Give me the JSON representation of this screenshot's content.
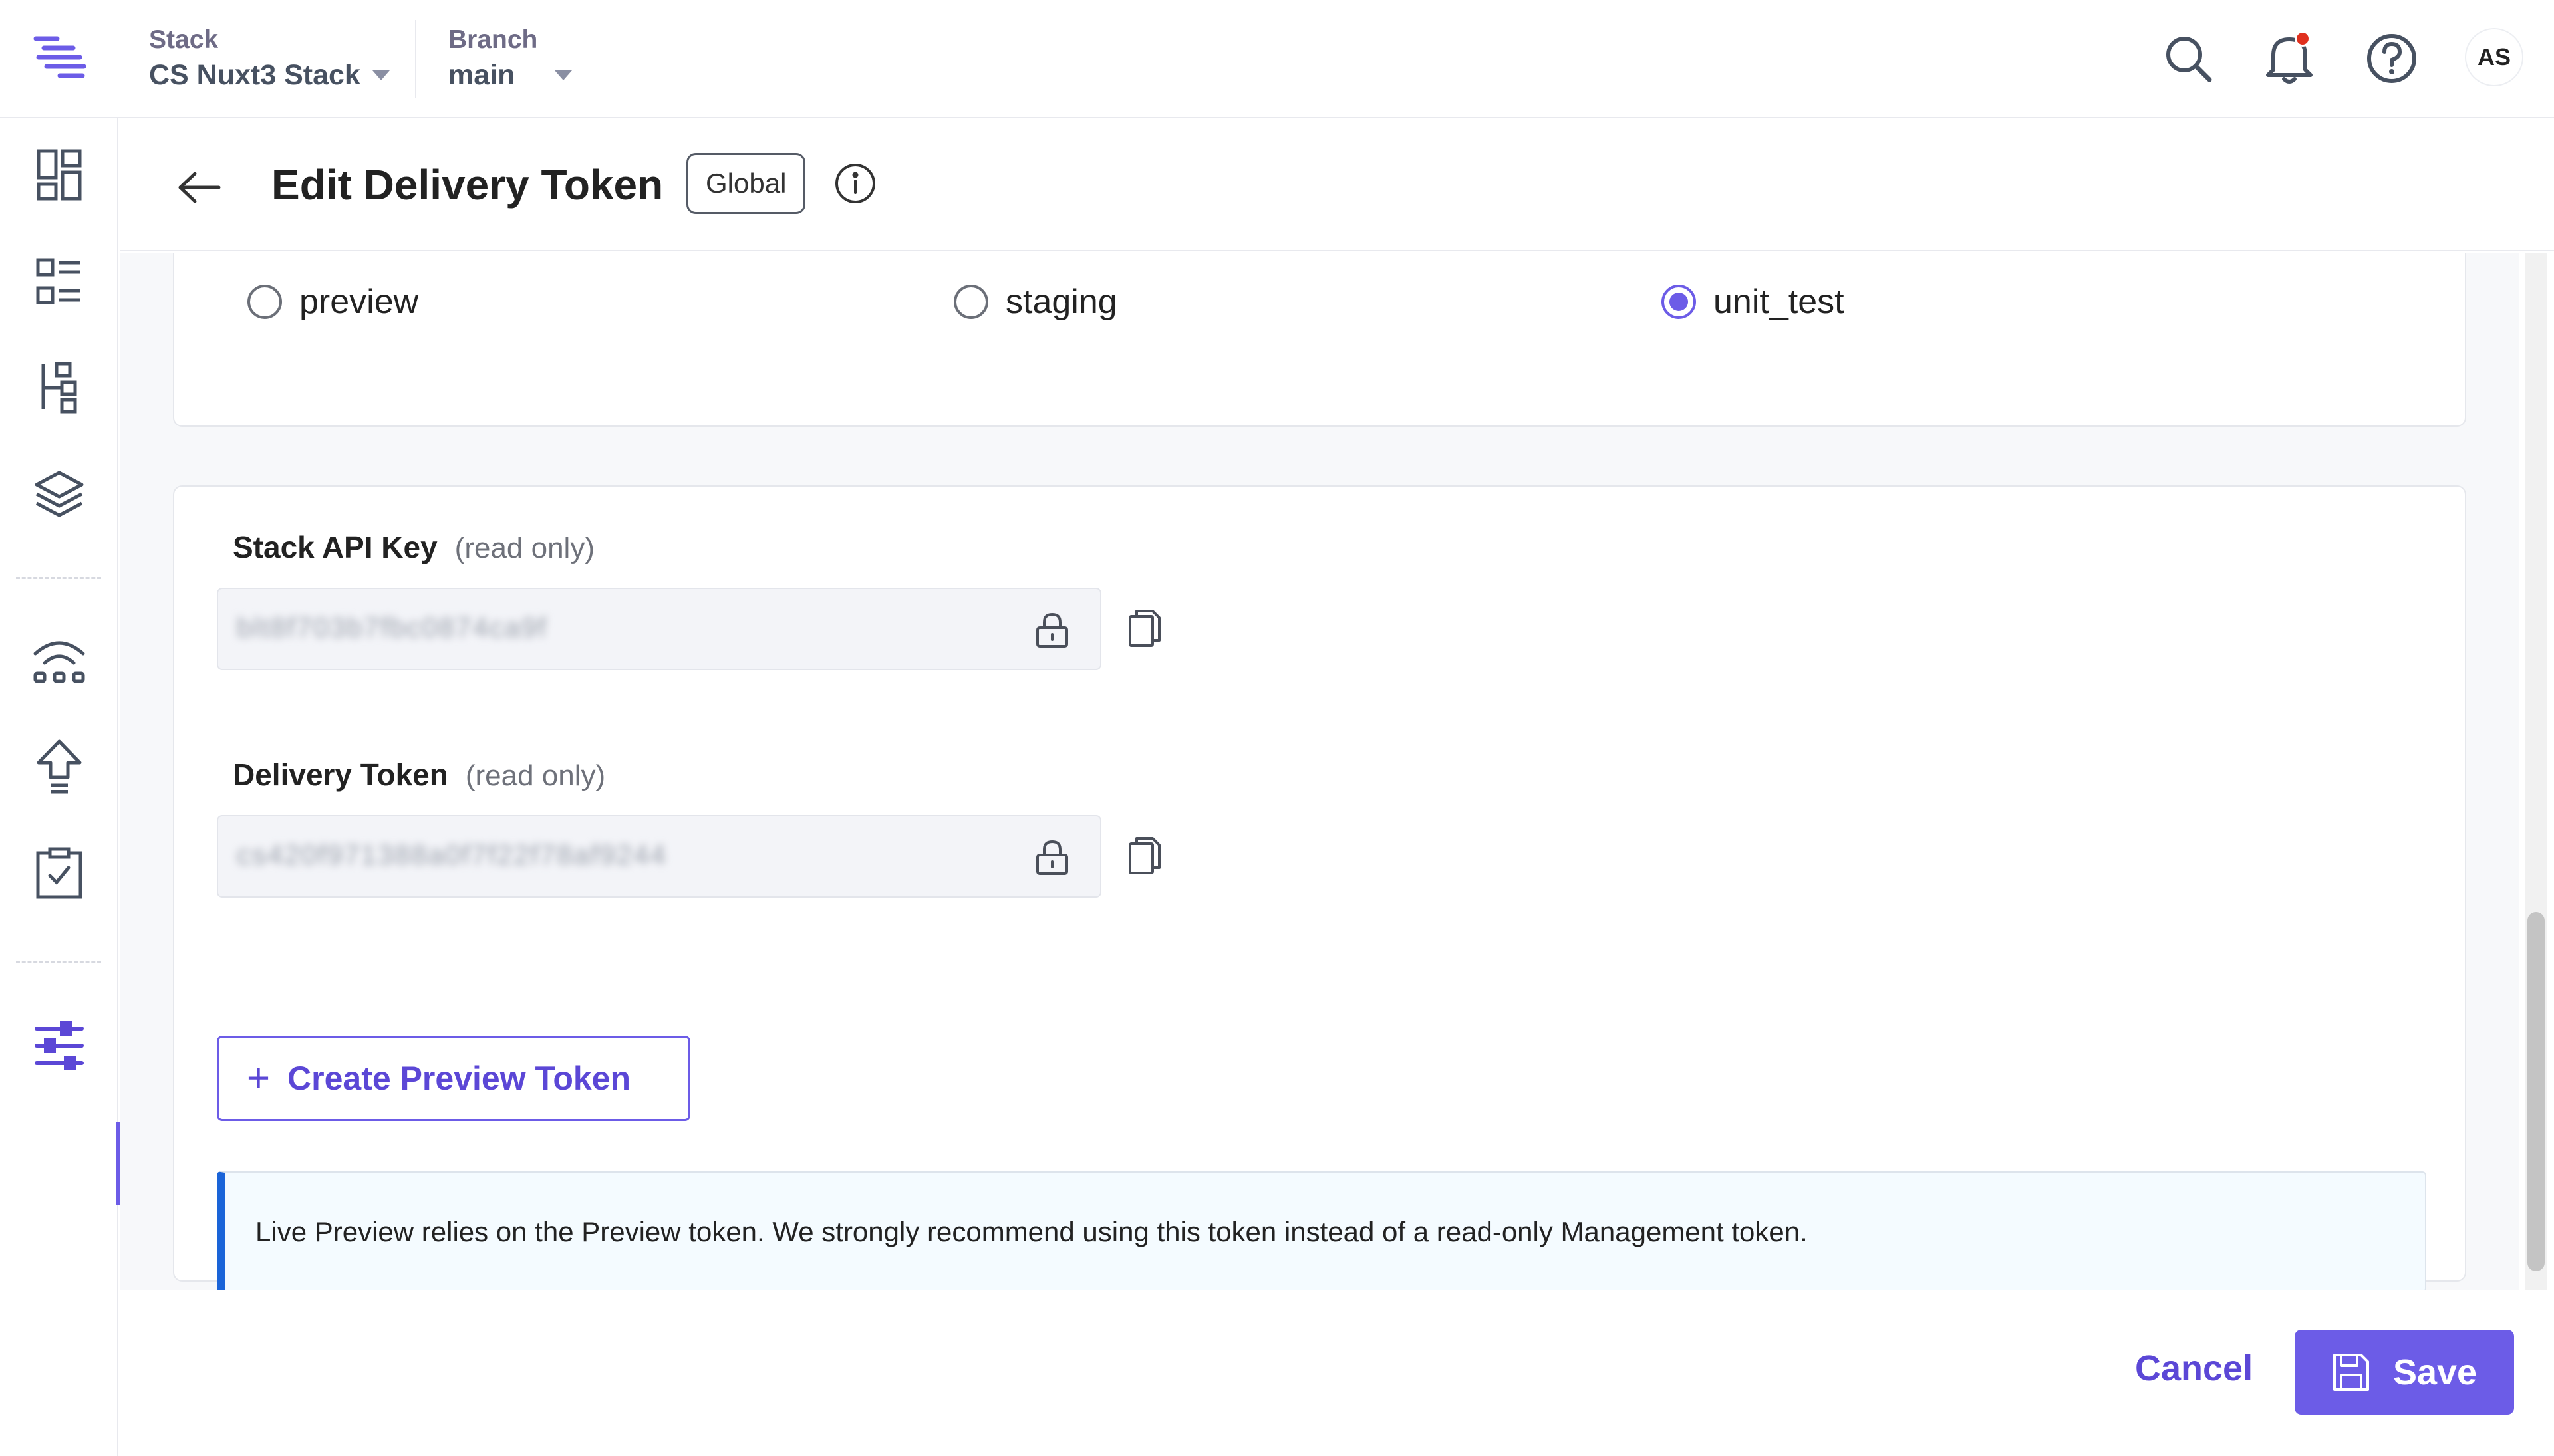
{
  "header": {
    "stack_label": "Stack",
    "stack_name": "CS Nuxt3 Stack",
    "branch_label": "Branch",
    "branch_name": "main",
    "avatar_initials": "AS",
    "icons": [
      "search-icon",
      "bell-icon",
      "help-icon"
    ]
  },
  "sidebar": {
    "items": [
      "dashboard-icon",
      "entries-icon",
      "content-models-icon",
      "assets-icon",
      "releases-icon",
      "deploy-icon",
      "tasks-icon",
      "settings-icon"
    ],
    "active": "settings-icon"
  },
  "page": {
    "title": "Edit Delivery Token",
    "scope_badge": "Global"
  },
  "environments": {
    "options": [
      {
        "label": "preview",
        "checked": false
      },
      {
        "label": "staging",
        "checked": false
      },
      {
        "label": "unit_test",
        "checked": true
      }
    ]
  },
  "keys": {
    "api_key_label": "Stack API Key",
    "api_key_readonly": "(read only)",
    "api_key_value": "blt8f703b7fbc0874ca9f",
    "delivery_token_label": "Delivery Token",
    "delivery_token_readonly": "(read only)",
    "delivery_token_value": "cs420f971388a0f7f22f78af9244"
  },
  "actions": {
    "create_preview_token": "Create Preview Token",
    "notice": "Live Preview relies on the Preview token. We strongly recommend using this token instead of a read-only Management token.",
    "cancel": "Cancel",
    "save": "Save"
  },
  "colors": {
    "accent": "#6c5ce7",
    "notice_border": "#1a64d8",
    "notification_dot": "#e0301e"
  }
}
